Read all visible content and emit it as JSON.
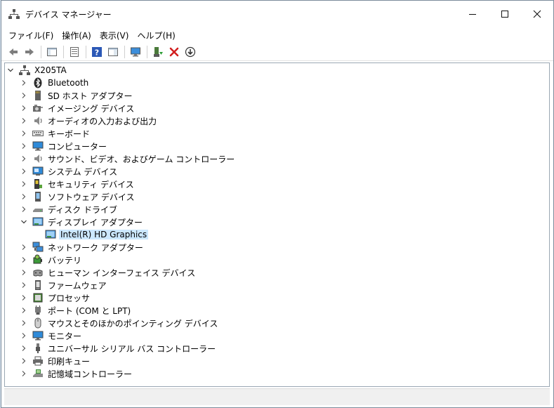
{
  "window": {
    "title": "デバイス マネージャー"
  },
  "controls": {
    "minimize": "—",
    "maximize": "☐",
    "close": "✕"
  },
  "menu": [
    "ファイル(F)",
    "操作(A)",
    "表示(V)",
    "ヘルプ(H)"
  ],
  "tree": {
    "root": "X205TA",
    "categories": [
      {
        "label": "Bluetooth",
        "icon": "bluetooth-icon"
      },
      {
        "label": "SD ホスト アダプター",
        "icon": "sd-host-icon"
      },
      {
        "label": "イメージング デバイス",
        "icon": "camera-icon"
      },
      {
        "label": "オーディオの入力および出力",
        "icon": "speaker-icon"
      },
      {
        "label": "キーボード",
        "icon": "keyboard-icon"
      },
      {
        "label": "コンピューター",
        "icon": "computer-icon"
      },
      {
        "label": "サウンド、ビデオ、およびゲーム コントローラー",
        "icon": "sound-icon"
      },
      {
        "label": "システム デバイス",
        "icon": "system-device-icon"
      },
      {
        "label": "セキュリティ デバイス",
        "icon": "security-device-icon"
      },
      {
        "label": "ソフトウェア デバイス",
        "icon": "software-device-icon"
      },
      {
        "label": "ディスク ドライブ",
        "icon": "disk-drive-icon"
      },
      {
        "label": "ディスプレイ アダプター",
        "icon": "display-adapter-icon",
        "expanded": true,
        "children": [
          "Intel(R) HD Graphics"
        ]
      },
      {
        "label": "ネットワーク アダプター",
        "icon": "network-adapter-icon"
      },
      {
        "label": "バッテリ",
        "icon": "battery-icon"
      },
      {
        "label": "ヒューマン インターフェイス デバイス",
        "icon": "hid-icon"
      },
      {
        "label": "ファームウェア",
        "icon": "firmware-icon"
      },
      {
        "label": "プロセッサ",
        "icon": "processor-icon"
      },
      {
        "label": "ポート (COM と LPT)",
        "icon": "port-icon"
      },
      {
        "label": "マウスとそのほかのポインティング デバイス",
        "icon": "mouse-icon"
      },
      {
        "label": "モニター",
        "icon": "monitor-icon"
      },
      {
        "label": "ユニバーサル シリアル バス コントローラー",
        "icon": "usb-icon"
      },
      {
        "label": "印刷キュー",
        "icon": "printer-icon"
      },
      {
        "label": "記憶域コントローラー",
        "icon": "storage-controller-icon"
      }
    ]
  }
}
